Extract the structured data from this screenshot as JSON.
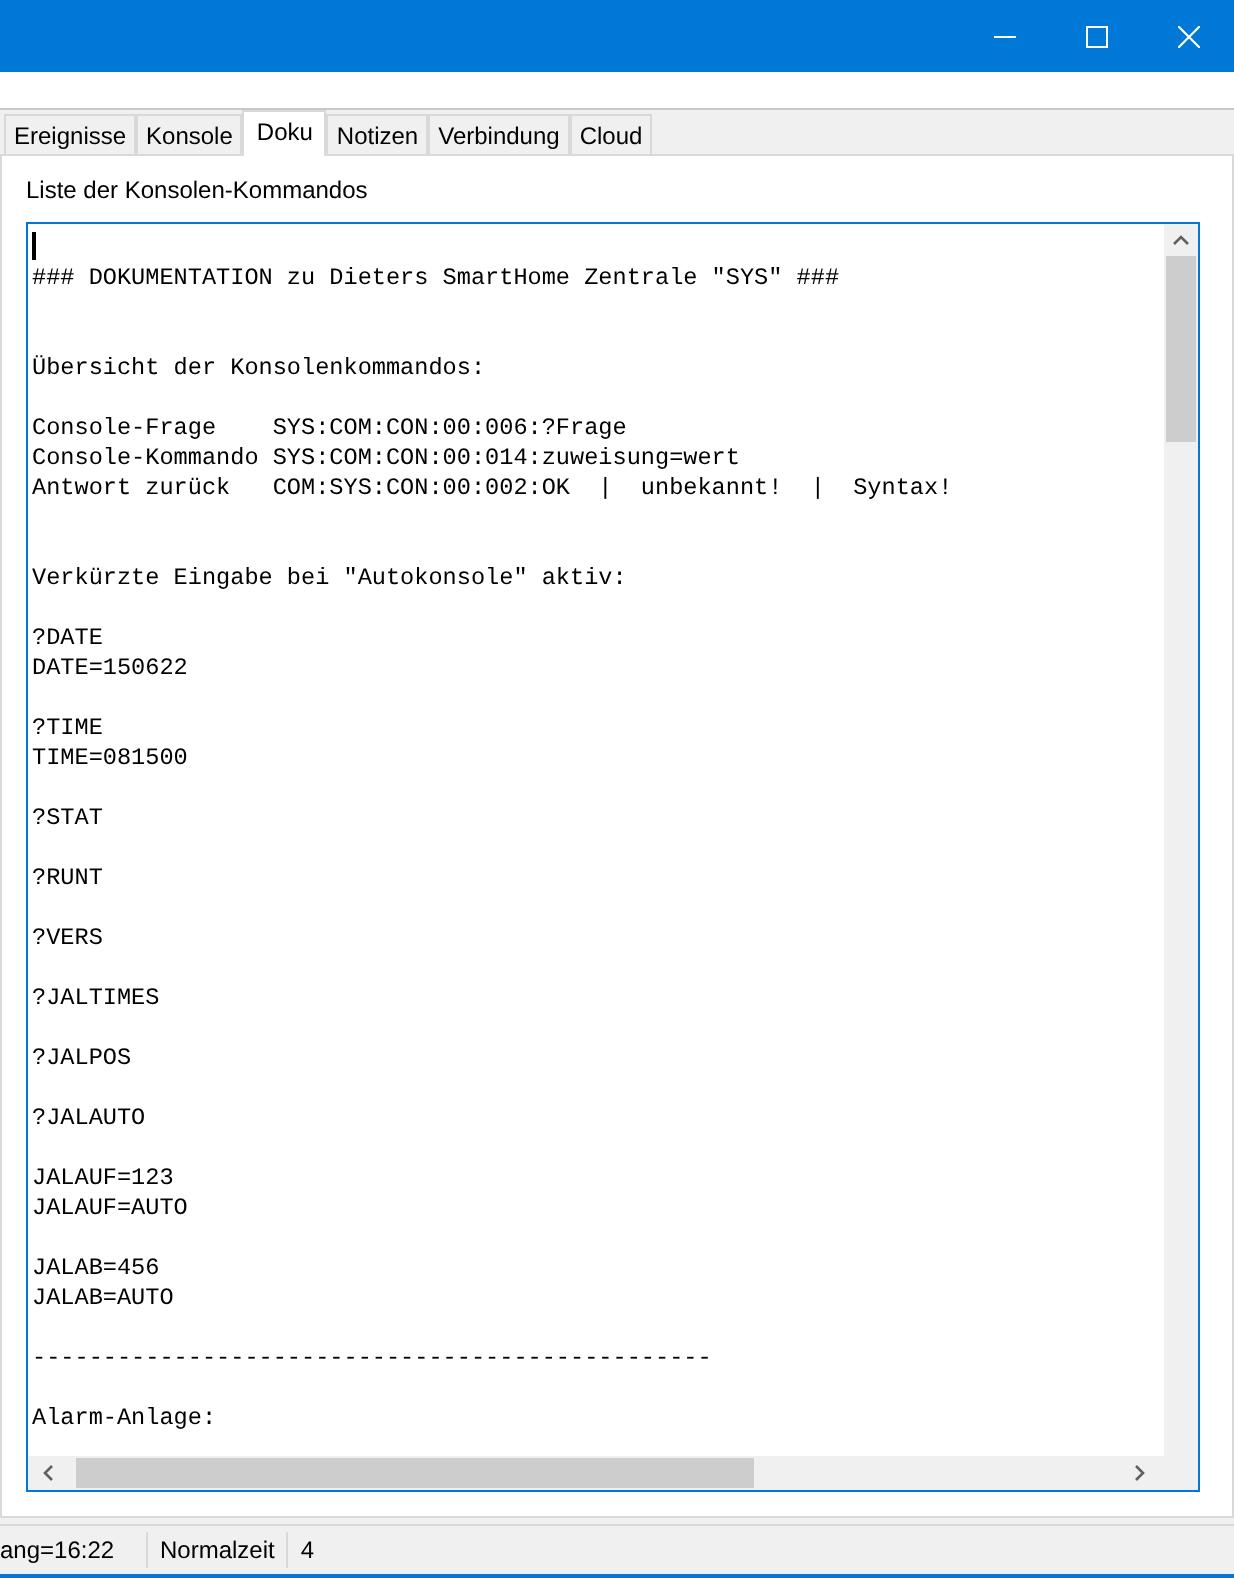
{
  "window": {
    "controls": [
      {
        "kind": "minimize"
      },
      {
        "kind": "maximize"
      },
      {
        "kind": "close"
      }
    ]
  },
  "tabs": [
    {
      "label": "Ereignisse",
      "selected": false
    },
    {
      "label": "Konsole",
      "selected": false
    },
    {
      "label": "Doku",
      "selected": true
    },
    {
      "label": "Notizen",
      "selected": false
    },
    {
      "label": "Verbindung",
      "selected": false
    },
    {
      "label": "Cloud",
      "selected": false
    }
  ],
  "panel": {
    "label": "Liste der Konsolen-Kommandos",
    "document": "### DOKUMENTATION zu Dieters SmartHome Zentrale \"SYS\" ###\n\n\nÜbersicht der Konsolenkommandos:\n\nConsole-Frage    SYS:COM:CON:00:006:?Frage\nConsole-Kommando SYS:COM:CON:00:014:zuweisung=wert\nAntwort zurück   COM:SYS:CON:00:002:OK  |  unbekannt!  |  Syntax!\n\n\nVerkürzte Eingabe bei \"Autokonsole\" aktiv:\n\n?DATE\nDATE=150622\n\n?TIME\nTIME=081500\n\n?STAT\n\n?RUNT\n\n?VERS\n\n?JALTIMES\n\n?JALPOS\n\n?JALAUTO\n\nJALAUF=123\nJALAUF=AUTO\n\nJALAB=456\nJALAB=AUTO\n\n------------------------------------------------\n\nAlarm-Anlage:"
  },
  "status_bar": [
    "ang=16:22",
    "Normalzeit",
    "4"
  ]
}
